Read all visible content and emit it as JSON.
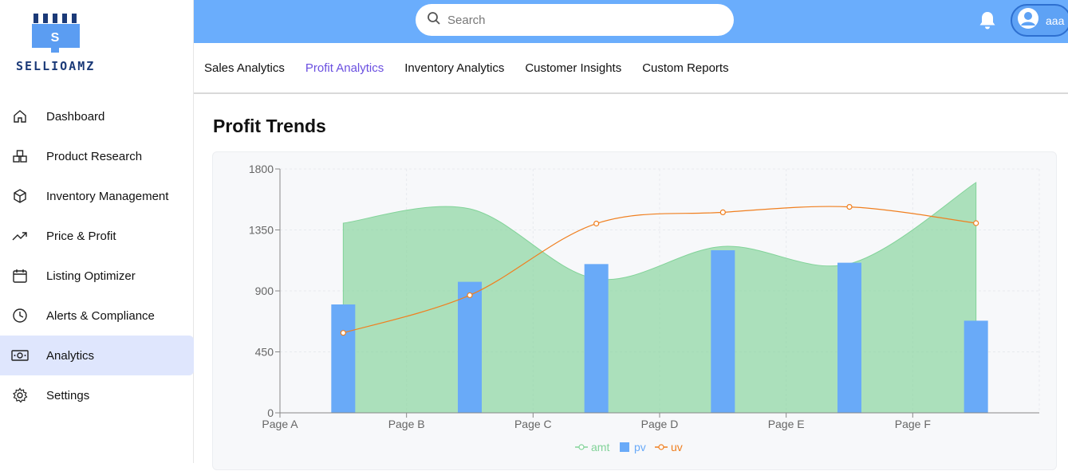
{
  "brand": {
    "name": "SELLIOAMZ",
    "logo_letter": "S"
  },
  "sidebar": {
    "items": [
      {
        "label": "Dashboard",
        "icon": "home-icon",
        "active": false
      },
      {
        "label": "Product Research",
        "icon": "boxes-icon",
        "active": false
      },
      {
        "label": "Inventory Management",
        "icon": "cube-icon",
        "active": false
      },
      {
        "label": "Price & Profit",
        "icon": "trending-up-icon",
        "active": false
      },
      {
        "label": "Listing Optimizer",
        "icon": "calendar-icon",
        "active": false
      },
      {
        "label": "Alerts & Compliance",
        "icon": "clock-icon",
        "active": false
      },
      {
        "label": "Analytics",
        "icon": "cash-icon",
        "active": true
      },
      {
        "label": "Settings",
        "icon": "gear-icon",
        "active": false
      }
    ]
  },
  "header": {
    "search_placeholder": "Search",
    "user_name": "aaa"
  },
  "tabs": [
    {
      "label": "Sales Analytics",
      "active": false
    },
    {
      "label": "Profit Analytics",
      "active": true
    },
    {
      "label": "Inventory Analytics",
      "active": false
    },
    {
      "label": "Customer Insights",
      "active": false
    },
    {
      "label": "Custom Reports",
      "active": false
    }
  ],
  "main": {
    "title": "Profit Trends"
  },
  "colors": {
    "accent": "#6a4fe0",
    "topbar": "#6aadfc",
    "amt": "#82d399",
    "pv": "#69aaf8",
    "uv": "#f07f1f"
  },
  "chart_data": {
    "type": "area",
    "categories": [
      "Page A",
      "Page B",
      "Page C",
      "Page D",
      "Page E",
      "Page F"
    ],
    "ylim": [
      0,
      1800
    ],
    "yticks": [
      0,
      450,
      900,
      1350,
      1800
    ],
    "grid": true,
    "legend_position": "bottom",
    "series": [
      {
        "name": "amt",
        "kind": "area",
        "color": "#82d399",
        "values": [
          1400,
          1506,
          989,
          1228,
          1100,
          1700
        ]
      },
      {
        "name": "pv",
        "kind": "bar",
        "color": "#69aaf8",
        "values": [
          800,
          967,
          1098,
          1200,
          1108,
          680
        ]
      },
      {
        "name": "uv",
        "kind": "line",
        "color": "#f07f1f",
        "values": [
          590,
          868,
          1397,
          1480,
          1520,
          1400
        ]
      }
    ]
  }
}
